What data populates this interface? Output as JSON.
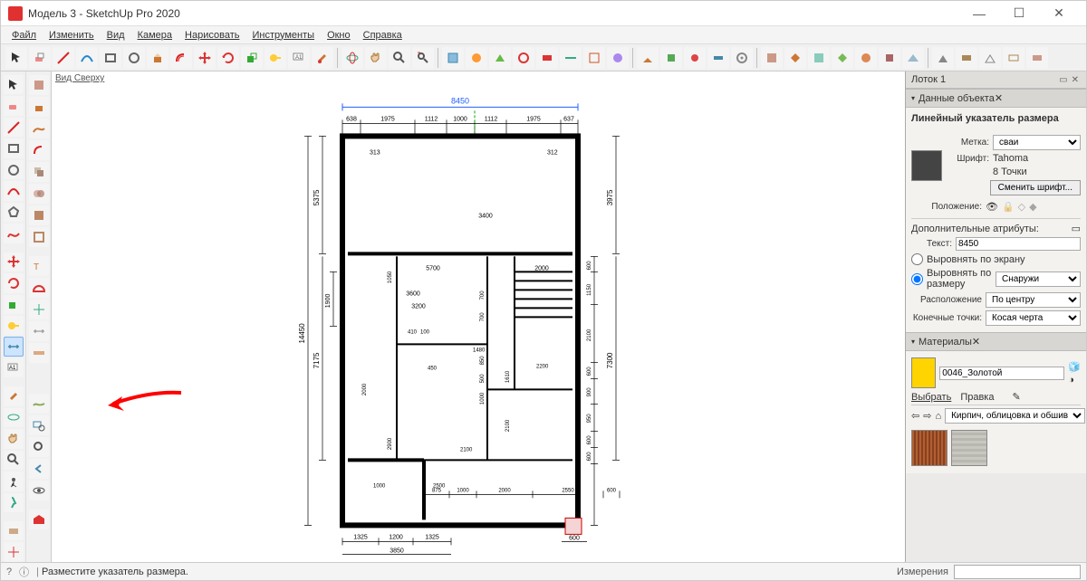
{
  "title": "Модель 3 - SketchUp Pro 2020",
  "menu": [
    "Файл",
    "Изменить",
    "Вид",
    "Камера",
    "Нарисовать",
    "Инструменты",
    "Окно",
    "Справка"
  ],
  "view_label": "Вид Сверху",
  "tray": {
    "title": "Лоток 1",
    "entity": {
      "header": "Данные объекта",
      "subtitle": "Линейный указатель размера",
      "label_label": "Метка:",
      "label_value": "сваи",
      "font_label": "Шрифт:",
      "font_value": "Tahoma",
      "font_size": "8 Точки",
      "change_font": "Сменить шрифт...",
      "position_label": "Положение:",
      "extra_header": "Дополнительные атрибуты:",
      "text_label": "Текст:",
      "text_value": "8450",
      "align_screen": "Выровнять по экрану",
      "align_dim": "Выровнять по размеру",
      "align_value": "Снаружи",
      "placement_label": "Расположение",
      "placement_value": "По центру",
      "endpoints_label": "Конечные точки:",
      "endpoints_value": "Косая черта"
    },
    "materials": {
      "header": "Материалы",
      "name": "0046_Золотой",
      "tab_select": "Выбрать",
      "tab_edit": "Правка",
      "category": "Кирпич, облицовка и обшив"
    }
  },
  "status": {
    "hint": "Разместите указатель размера.",
    "meas_label": "Измерения"
  },
  "dims": {
    "top_overall": "8450",
    "top_segments": [
      "638",
      "1975",
      "1112",
      "1000",
      "1112",
      "1975",
      "637"
    ],
    "left_overall": "14450",
    "left_upper": "5375",
    "left_lower": "7175",
    "left_room": "1900",
    "right_overall": "7300",
    "right_top": "3975",
    "right_segs": [
      "600",
      "1150",
      "2100",
      "600",
      "900",
      "950",
      "600",
      "600"
    ],
    "bottom": [
      "1325",
      "1200",
      "1325"
    ],
    "bottom_sum": "3850",
    "bottom_right": [
      "875",
      "1000",
      "2000",
      "2550",
      "600"
    ],
    "bottom_r600": "600",
    "int": {
      "w313": "313",
      "w312": "312",
      "w3400": "3400",
      "w5700": "5700",
      "w2000": "2000",
      "w1050": "1050",
      "w3600": "3600",
      "w3200": "3200",
      "w410": "410",
      "w100": "100",
      "w1480": "1480",
      "w2000b": "2000",
      "w700a": "700",
      "w700b": "700",
      "w500": "500",
      "w850": "850",
      "w1000": "1000",
      "w450": "450",
      "w2200": "2200",
      "w1610": "1610",
      "w2100": "2100",
      "w2900": "2900",
      "w2500": "2500",
      "w1000b": "1000",
      "w2100b": "2100"
    }
  }
}
